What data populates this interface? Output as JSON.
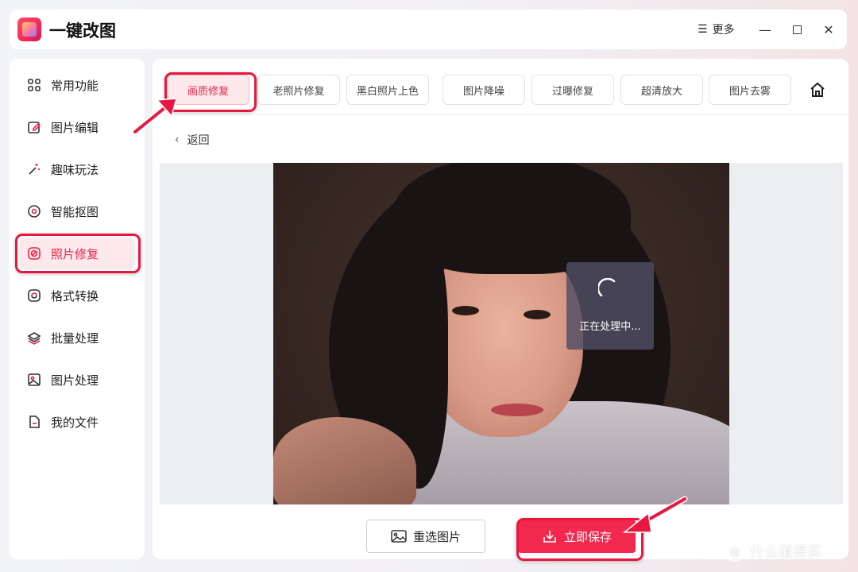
{
  "app": {
    "title": "一键改图",
    "more_label": "更多",
    "window_controls": [
      "minimize-icon",
      "maximize-icon",
      "close-icon"
    ]
  },
  "sidebar": {
    "items": [
      {
        "label": "常用功能",
        "icon": "grid-icon",
        "active": false
      },
      {
        "label": "图片编辑",
        "icon": "edit-icon",
        "active": false
      },
      {
        "label": "趣味玩法",
        "icon": "magic-wand-icon",
        "active": false
      },
      {
        "label": "智能抠图",
        "icon": "target-icon",
        "active": false
      },
      {
        "label": "照片修复",
        "icon": "photo-repair-icon",
        "active": true
      },
      {
        "label": "格式转换",
        "icon": "convert-icon",
        "active": false
      },
      {
        "label": "批量处理",
        "icon": "layers-icon",
        "active": false
      },
      {
        "label": "图片处理",
        "icon": "image-icon",
        "active": false
      },
      {
        "label": "我的文件",
        "icon": "file-icon",
        "active": false
      }
    ]
  },
  "tabs": [
    {
      "label": "画质修复",
      "active": true
    },
    {
      "label": "老照片修复",
      "active": false
    },
    {
      "label": "黑白照片上色",
      "active": false
    },
    {
      "label": "图片降噪",
      "active": false
    },
    {
      "label": "过曝修复",
      "active": false
    },
    {
      "label": "超清放大",
      "active": false
    },
    {
      "label": "图片去雾",
      "active": false
    }
  ],
  "main": {
    "back_label": "返回",
    "processing_text": "正在处理中...",
    "reselect_label": "重选图片",
    "save_label": "立即保存"
  },
  "watermark": {
    "text": "什么值得买"
  },
  "colors": {
    "accent": "#f2284e",
    "annotation_red": "#e8173f",
    "active_bg": "#fde8ec"
  }
}
